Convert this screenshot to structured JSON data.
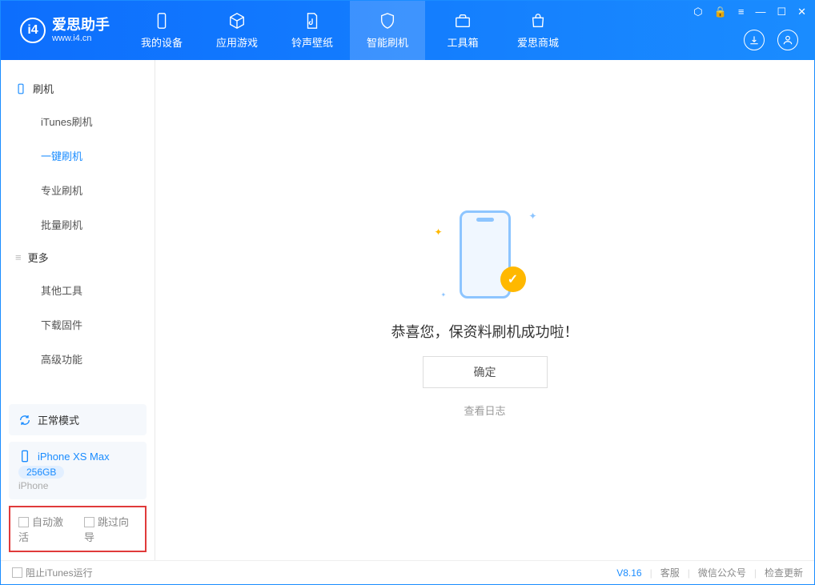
{
  "app": {
    "title": "爱思助手",
    "subtitle": "www.i4.cn"
  },
  "tabs": [
    {
      "label": "我的设备"
    },
    {
      "label": "应用游戏"
    },
    {
      "label": "铃声壁纸"
    },
    {
      "label": "智能刷机"
    },
    {
      "label": "工具箱"
    },
    {
      "label": "爱思商城"
    }
  ],
  "sidebar": {
    "group1": "刷机",
    "items1": [
      "iTunes刷机",
      "一键刷机",
      "专业刷机",
      "批量刷机"
    ],
    "group2": "更多",
    "items2": [
      "其他工具",
      "下载固件",
      "高级功能"
    ]
  },
  "mode": {
    "label": "正常模式"
  },
  "device": {
    "name": "iPhone XS Max",
    "storage": "256GB",
    "type": "iPhone"
  },
  "options": {
    "auto_activate": "自动激活",
    "skip_guide": "跳过向导"
  },
  "main": {
    "success": "恭喜您，保资料刷机成功啦！",
    "ok": "确定",
    "view_log": "查看日志"
  },
  "footer": {
    "block_itunes": "阻止iTunes运行",
    "version": "V8.16",
    "links": [
      "客服",
      "微信公众号",
      "检查更新"
    ]
  }
}
